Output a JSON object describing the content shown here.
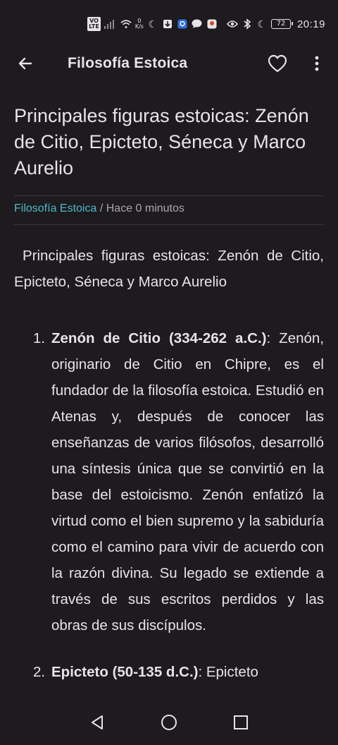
{
  "status_bar": {
    "volte_top": "VO",
    "volte_bottom": "LTE",
    "speed_value": "0",
    "speed_unit": "K/s",
    "battery": "72",
    "time": "20:19"
  },
  "app_bar": {
    "title": "Filosofía Estoica"
  },
  "article": {
    "title": "Principales figuras estoicas: Zenón de Citio, Epicteto, Séneca y Marco Aurelio",
    "category": "Filosofía Estoica",
    "separator": " / ",
    "time_ago": "Hace 0 minutos",
    "intro": "Principales figuras estoicas: Zenón de Citio, Epicteto, Séneca y Marco Aurelio",
    "figures": [
      {
        "number": "1.",
        "name": "Zenón de Citio (334-262 a.C.)",
        "text": ": Zenón, originario de Citio en Chipre, es el fundador de la filosofía estoica. Estudió en Atenas y, después de conocer las enseñanzas de varios filósofos, desarrolló una síntesis única que se convirtió en la base del estoicismo. Zenón enfatizó la virtud como el bien supremo y la sabiduría como el camino para vivir de acuerdo con la razón divina. Su legado se extiende a través de sus escritos perdidos y las obras de sus discípulos."
      },
      {
        "number": "2.",
        "name": "Epicteto (50-135 d.C.)",
        "text": ": Epicteto"
      }
    ]
  }
}
